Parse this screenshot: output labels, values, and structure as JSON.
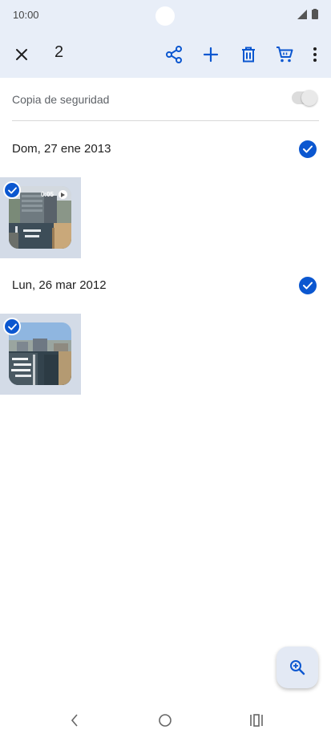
{
  "status_bar": {
    "time": "10:00",
    "signal_icon": "signal-icon",
    "battery_icon": "battery-icon"
  },
  "toolbar": {
    "selected_count": "2",
    "close_icon": "close-icon",
    "share_icon": "share-icon",
    "add_icon": "add-icon",
    "delete_icon": "trash-icon",
    "order_icon": "cart-icon",
    "more_icon": "more-vert-icon"
  },
  "backup": {
    "label": "Copia de seguridad",
    "enabled": false
  },
  "groups": [
    {
      "date": "Dom, 27 ene 2013",
      "selected": true,
      "items": [
        {
          "type": "video",
          "duration": "0:05",
          "selected": true
        }
      ]
    },
    {
      "date": "Lun, 26 mar 2012",
      "selected": true,
      "items": [
        {
          "type": "photo",
          "selected": true
        }
      ]
    }
  ],
  "fab": {
    "icon": "zoom-in-icon"
  },
  "navigation": {
    "back_icon": "back-icon",
    "home_icon": "home-icon",
    "recents_icon": "recents-icon"
  },
  "colors": {
    "accent": "#0b57d0",
    "header_bg": "#e8eef8",
    "selection_bg": "#d3dbe7"
  }
}
